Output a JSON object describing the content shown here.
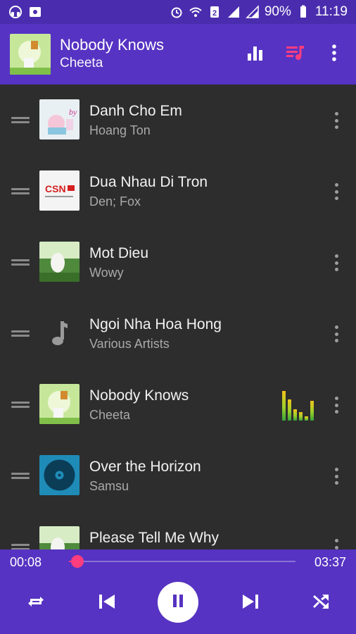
{
  "status_bar": {
    "battery": "90%",
    "time": "11:19"
  },
  "now_playing": {
    "title": "Nobody Knows",
    "artist": "Cheeta"
  },
  "tracks": [
    {
      "title": "Danh Cho Em",
      "artist": "Hoang Ton",
      "art": "pastel-cover"
    },
    {
      "title": "Dua Nhau Di Tron",
      "artist": "Den; Fox",
      "art": "csn-logo",
      "art_text": "CSN"
    },
    {
      "title": "Mot Dieu",
      "artist": "Wowy",
      "art": "nature-photo"
    },
    {
      "title": "Ngoi Nha Hoa Hong",
      "artist": "Various Artists",
      "art": "music-note-icon"
    },
    {
      "title": "Nobody Knows",
      "artist": "Cheeta",
      "art": "green-cover",
      "playing": true
    },
    {
      "title": "Over the Horizon",
      "artist": "Samsu",
      "art": "blue-disc"
    },
    {
      "title": "Please Tell Me Why",
      "artist": "",
      "art": "nature-photo"
    }
  ],
  "player": {
    "current_time": "00:08",
    "duration": "03:37",
    "progress": 0.037
  },
  "colors": {
    "status_bar": "#4a2dae",
    "header": "#5633c2",
    "list_bg": "#2d2d2d",
    "accent": "#ff3d7f",
    "queue_icon": "#ff3d7f"
  }
}
